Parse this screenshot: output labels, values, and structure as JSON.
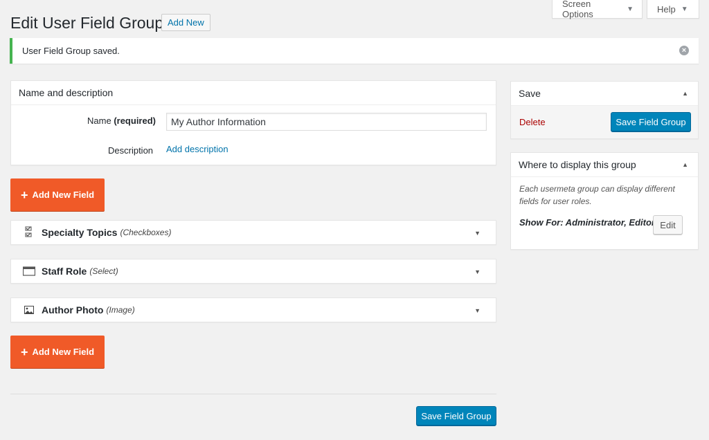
{
  "top_tabs": {
    "screen_options": "Screen Options",
    "help": "Help"
  },
  "header": {
    "title": "Edit User Field Group",
    "add_new": "Add New"
  },
  "notice": {
    "message": "User Field Group saved."
  },
  "name_box": {
    "title": "Name and description",
    "name_label": "Name",
    "name_required": "(required)",
    "name_value": "My Author Information",
    "description_label": "Description",
    "add_description": "Add description"
  },
  "add_field_label": "Add New Field",
  "fields": [
    {
      "name": "Specialty Topics",
      "type": "(Checkboxes)",
      "icon": "checkboxes-icon"
    },
    {
      "name": "Staff Role",
      "type": "(Select)",
      "icon": "select-icon"
    },
    {
      "name": "Author Photo",
      "type": "(Image)",
      "icon": "image-icon"
    }
  ],
  "save_box": {
    "title": "Save",
    "delete": "Delete",
    "save_button": "Save Field Group"
  },
  "display_box": {
    "title": "Where to display this group",
    "description": "Each usermeta group can display different fields for user roles.",
    "show_for": "Show For: Administrator, Editor",
    "edit": "Edit"
  },
  "bottom_save": "Save Field Group",
  "colors": {
    "accent_orange": "#f05a28",
    "primary_blue": "#0085ba",
    "success_green": "#46b450",
    "delete_red": "#aa0000"
  }
}
